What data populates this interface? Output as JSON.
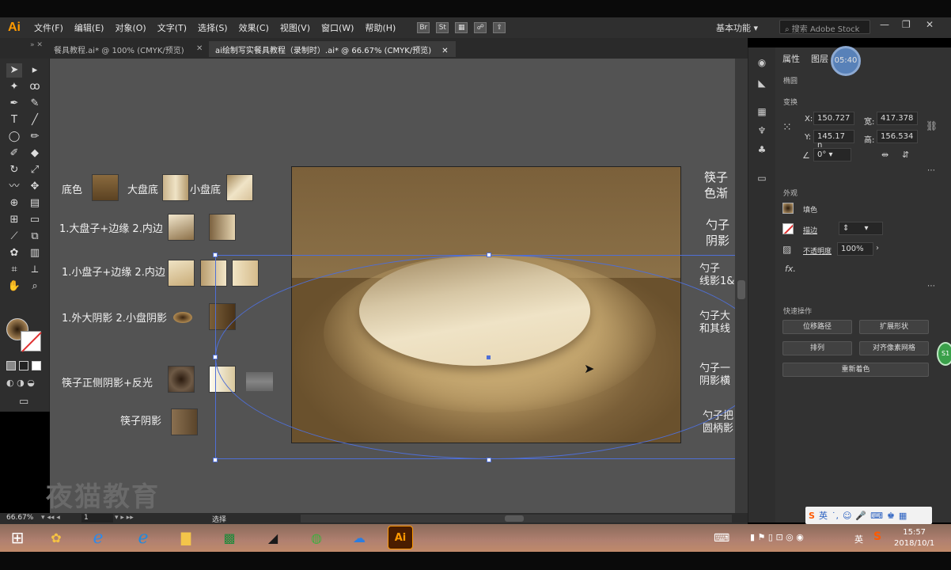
{
  "app": {
    "logo": "Ai",
    "menu": [
      "文件(F)",
      "编辑(E)",
      "对象(O)",
      "文字(T)",
      "选择(S)",
      "效果(C)",
      "视图(V)",
      "窗口(W)",
      "帮助(H)"
    ],
    "bridge_label": "Br",
    "stock_label": "St",
    "workspace": "基本功能",
    "search_placeholder": "搜索 Adobe Stock"
  },
  "tabs": [
    {
      "label": "餐具教程.ai* @ 100% (CMYK/预览)",
      "active": false
    },
    {
      "label": "ai绘制写实餐具教程（录制时）.ai* @ 66.67% (CMYK/预览)",
      "active": true
    }
  ],
  "legend": {
    "row1": {
      "a": "底色",
      "b": "大盘底",
      "c": "小盘底"
    },
    "row2": "1.大盘子+边缘 2.内边",
    "row3": "1.小盘子+边缘 2.内边",
    "row4": "1.外大阴影 2.小盘阴影",
    "row5": "筷子正侧阴影+反光",
    "row6": "筷子阴影"
  },
  "right_notes": [
    "筷子",
    "色渐",
    "勺子",
    "阴影",
    "勺子",
    "线影1&",
    "勺子大",
    "和其线",
    "勺子一",
    "阴影横",
    "勺子把",
    "圆柄影"
  ],
  "watermark": "夜猫教育",
  "properties": {
    "tab_properties": "属性",
    "tab_layers": "图层",
    "timer": "05:40",
    "object_type": "椭圆",
    "transform_title": "变换",
    "x_label": "X:",
    "x_value": "150.727",
    "y_label": "Y:",
    "y_value": "145.17 n",
    "w_label": "宽:",
    "w_value": "417.378",
    "h_label": "高:",
    "h_value": "156.534",
    "angle_value": "0°",
    "appearance_title": "外观",
    "fill_label": "填色",
    "stroke_label": "描边",
    "opacity_label": "不透明度",
    "opacity_value": "100%",
    "fx_label": "fx.",
    "quick_actions_title": "快速操作",
    "btn_offset_path": "位移路径",
    "btn_expand_shape": "扩展形状",
    "btn_arrange": "排列",
    "btn_align_pixel": "对齐像素网格",
    "btn_recolor": "重新着色"
  },
  "status": {
    "zoom": "66.67%",
    "page": "1",
    "tool": "选择"
  },
  "taskbar": {
    "time": "15:57",
    "date": "2018/10/1",
    "ime": "英"
  },
  "colors": {
    "selection": "#4f6fd6",
    "ai_orange": "#ff9a00"
  }
}
